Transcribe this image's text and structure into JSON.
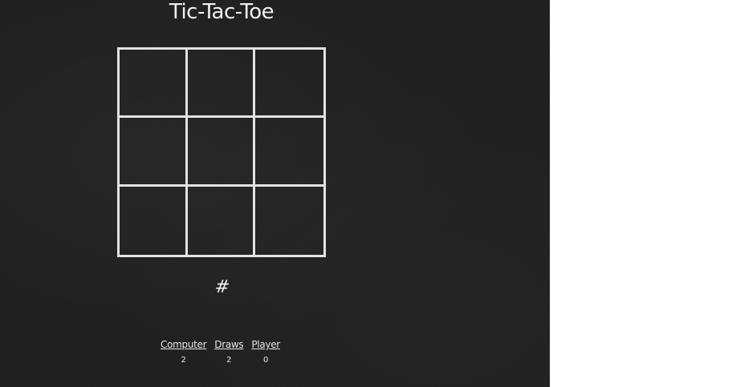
{
  "game": {
    "title": "Tic-Tac-Toe",
    "board": [
      [
        "",
        "",
        ""
      ],
      [
        "",
        "",
        ""
      ],
      [
        "",
        "",
        ""
      ]
    ],
    "reset_symbol": "#"
  },
  "scoreboard": {
    "computer": {
      "label": "Computer",
      "value": "2"
    },
    "draws": {
      "label": "Draws",
      "value": "2"
    },
    "player": {
      "label": "Player",
      "value": "0"
    }
  },
  "colors": {
    "chalkboard": "#1f1f1f",
    "chalk": "#e3e3e3"
  }
}
